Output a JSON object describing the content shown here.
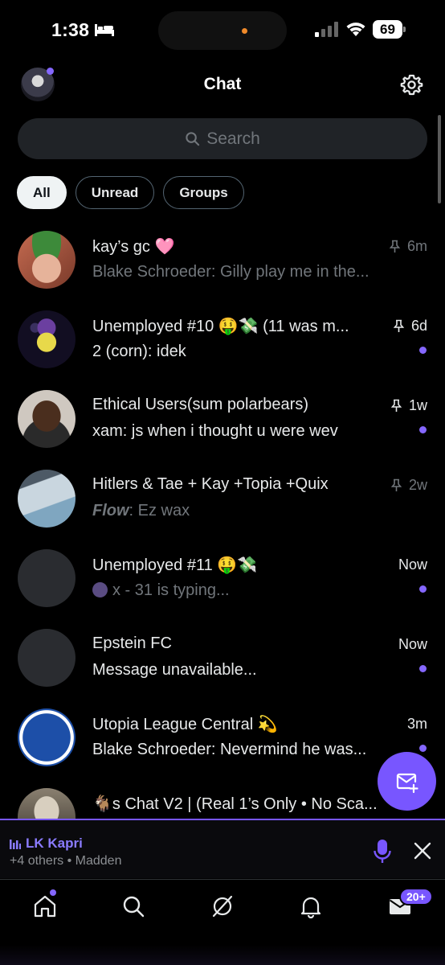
{
  "status": {
    "time": "1:38",
    "battery": "69",
    "icons": [
      "bed-icon",
      "signal-icon",
      "wifi-icon",
      "battery-icon"
    ]
  },
  "header": {
    "title": "Chat",
    "settings_icon": "gear-icon"
  },
  "search": {
    "placeholder": "Search"
  },
  "filters": {
    "items": [
      {
        "label": "All",
        "active": true
      },
      {
        "label": "Unread",
        "active": false
      },
      {
        "label": "Groups",
        "active": false
      }
    ]
  },
  "chats": [
    {
      "name": "kay’s gc 🩷",
      "preview_author": "",
      "preview": "Blake Schroeder: Gilly play me in the...",
      "time": "6m",
      "pinned": true,
      "unread": false,
      "preview_bright": false,
      "avatar_color": "#b0543b"
    },
    {
      "name": "Unemployed #10 🤑💸 (11 was m...",
      "preview_author": "",
      "preview": "2 (corn): idek",
      "time": "6d",
      "pinned": true,
      "unread": true,
      "preview_bright": true,
      "avatar_color": "#1b1530"
    },
    {
      "name": "Ethical Users(sum polarbears)",
      "preview_author": "",
      "preview": "xam: js when i thought u were wev",
      "time": "1w",
      "pinned": true,
      "unread": true,
      "preview_bright": true,
      "avatar_color": "#5a3b2a"
    },
    {
      "name": "Hitlers & Tae + Kay +Topia +Quix",
      "preview_author": "Flow",
      "preview": ": Ez wax",
      "time": "2w",
      "pinned": true,
      "unread": false,
      "preview_bright": false,
      "avatar_color": "#9fb3c2"
    },
    {
      "name": "Unemployed #11 🤑💸",
      "preview_author": "",
      "preview": "x - 31 is typing...",
      "time": "Now",
      "pinned": false,
      "unread": true,
      "preview_bright": false,
      "typing": true,
      "avatar_color": "#2a2c30"
    },
    {
      "name": "Epstein FC",
      "preview_author": "",
      "preview": "Message unavailable...",
      "time": "Now",
      "pinned": false,
      "unread": true,
      "preview_bright": true,
      "avatar_color": "#2a2c30"
    },
    {
      "name": "Utopia League Central 💫",
      "preview_author": "",
      "preview": "Blake Schroeder: Nevermind he was...",
      "time": "3m",
      "pinned": false,
      "unread": true,
      "preview_bright": true,
      "avatar_color": "#1d4fa8"
    },
    {
      "name": "🐐s Chat V2 | (Real 1’s Only • No Sca...",
      "preview_author": "",
      "preview": "",
      "time": "",
      "pinned": false,
      "unread": false,
      "preview_bright": false,
      "avatar_color": "#6b6356"
    }
  ],
  "space": {
    "host": "LK Kapri",
    "subtitle": "+4 others • Madden"
  },
  "tabbar": {
    "items": [
      "home-icon",
      "search-icon",
      "grok-icon",
      "bell-icon",
      "mail-icon"
    ],
    "mail_badge": "20+"
  },
  "colors": {
    "accent": "#7856ff",
    "background": "#000000",
    "muted_text": "#71767b"
  }
}
